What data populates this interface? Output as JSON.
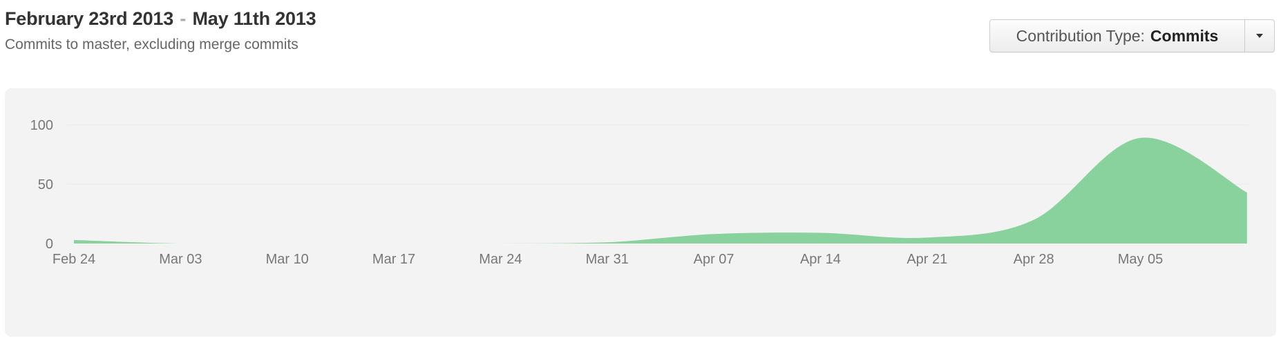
{
  "header": {
    "start_date": "February 23rd 2013",
    "separator": "-",
    "end_date": "May 11th 2013",
    "subtitle": "Commits to master, excluding merge commits"
  },
  "contribution_type": {
    "label": "Contribution Type:",
    "value": "Commits",
    "caret_icon": "caret-down-icon"
  },
  "colors": {
    "area_fill": "#8ad29d",
    "panel_background": "#f3f3f3",
    "grid": "#e9e9e9"
  },
  "chart_data": {
    "type": "area",
    "title": "",
    "xlabel": "",
    "ylabel": "",
    "ylim": [
      0,
      100
    ],
    "yticks": [
      0,
      50,
      100
    ],
    "x_tick_labels": [
      "Feb 24",
      "Mar 03",
      "Mar 10",
      "Mar 17",
      "Mar 24",
      "Mar 31",
      "Apr 07",
      "Apr 14",
      "Apr 21",
      "Apr 28",
      "May 05"
    ],
    "grid": true,
    "series": [
      {
        "x": [
          "2013-02-24",
          "2013-03-03",
          "2013-03-10",
          "2013-03-17",
          "2013-03-24",
          "2013-03-31",
          "2013-04-07",
          "2013-04-14",
          "2013-04-21",
          "2013-04-28",
          "2013-05-05",
          "2013-05-12"
        ],
        "values": [
          3,
          0,
          0,
          0,
          0,
          1,
          8,
          9,
          5,
          20,
          89,
          43
        ]
      }
    ]
  }
}
